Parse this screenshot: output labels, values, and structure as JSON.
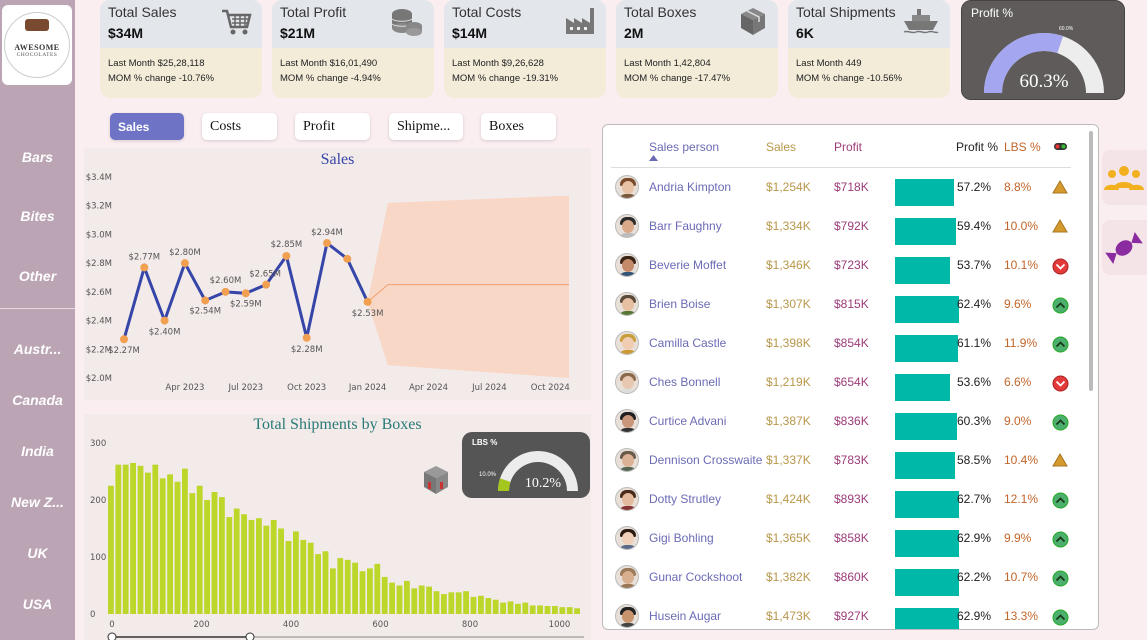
{
  "logo": {
    "line1": "AWESOME",
    "line2": "CHOCOLATES"
  },
  "sidebar": {
    "products": [
      "Bars",
      "Bites",
      "Other"
    ],
    "countries": [
      "Austr...",
      "Canada",
      "India",
      "New Z...",
      "UK",
      "USA"
    ]
  },
  "kpis": [
    {
      "title": "Total Sales",
      "value": "$34M",
      "last": "Last Month $25,28,118",
      "mom": "MOM % change -10.76%",
      "icon": "shopping-cart-icon"
    },
    {
      "title": "Total Profit",
      "value": "$21M",
      "last": "Last Month $16,01,490",
      "mom": "MOM % change -4.94%",
      "icon": "coins-icon"
    },
    {
      "title": "Total Costs",
      "value": "$14M",
      "last": "Last Month $9,26,628",
      "mom": "MOM % change -19.31%",
      "icon": "factory-icon"
    },
    {
      "title": "Total Boxes",
      "value": "2M",
      "last": "Last Month 1,42,804",
      "mom": "MOM % change -17.47%",
      "icon": "box-icon"
    },
    {
      "title": "Total Shipments",
      "value": "6K",
      "last": "Last Month 449",
      "mom": "MOM % change -10.56%",
      "icon": "ship-icon"
    }
  ],
  "profit_gauge": {
    "title": "Profit %",
    "value": "60.3%",
    "target": "60.0%",
    "fraction": 0.603
  },
  "tabs": [
    "Sales",
    "Costs",
    "Profit",
    "Shipme...",
    "Boxes"
  ],
  "active_tab": "Sales",
  "chart_data": [
    {
      "type": "line",
      "title": "Sales",
      "x": [
        "2023-01",
        "2023-02",
        "2023-03",
        "2023-04",
        "2023-05",
        "2023-06",
        "2023-07",
        "2023-08",
        "2023-09",
        "2023-10",
        "2023-11",
        "2023-12",
        "2024-01",
        "2024-02"
      ],
      "values": [
        2.27,
        2.77,
        2.4,
        2.8,
        2.54,
        2.6,
        2.59,
        2.65,
        2.85,
        2.28,
        2.94,
        2.83,
        2.53
      ],
      "data_labels": [
        "$2.27M",
        "$2.77M",
        "$2.40M",
        "$2.80M",
        "$2.54M",
        "$2.60M",
        "$2.59M",
        "$2.65M",
        "$2.85M",
        "$2.28M",
        "$2.94M",
        "",
        "$2.53M"
      ],
      "forecast": {
        "value": 2.65,
        "upper_end": 3.27,
        "lower_end": 2.0
      },
      "yticks": [
        "$3.4M",
        "$3.2M",
        "$3.0M",
        "$2.8M",
        "$2.6M",
        "$2.4M",
        "$2.2M",
        "$2.0M"
      ],
      "xticks": [
        "Apr 2023",
        "Jul 2023",
        "Oct 2023",
        "Jan 2024",
        "Apr 2024",
        "Jul 2024",
        "Oct 2024"
      ],
      "ylim": [
        2.0,
        3.4
      ],
      "color": "#3545a8",
      "marker_color": "#f0a050",
      "forecast_color": "#f8d5c2"
    },
    {
      "type": "bar",
      "title": "Total Shipments by Boxes",
      "values": [
        225,
        262,
        262,
        265,
        260,
        248,
        262,
        238,
        245,
        232,
        255,
        212,
        225,
        200,
        214,
        205,
        170,
        185,
        175,
        165,
        168,
        155,
        165,
        150,
        128,
        145,
        130,
        125,
        105,
        110,
        80,
        98,
        95,
        90,
        75,
        80,
        88,
        65,
        55,
        50,
        58,
        45,
        50,
        48,
        40,
        35,
        38,
        38,
        40,
        30,
        32,
        28,
        25,
        20,
        22,
        18,
        20,
        15,
        15,
        14,
        14,
        12,
        12,
        10
      ],
      "xticks": [
        "0",
        "200",
        "400",
        "600",
        "800",
        "1000"
      ],
      "yticks": [
        "300",
        "200",
        "100",
        "0"
      ],
      "ylim": [
        0,
        300
      ],
      "color": "#bcd62a"
    }
  ],
  "lbs_gauge": {
    "title": "LBS %",
    "value": "10.2%",
    "target": "10.0%",
    "fraction": 0.102
  },
  "table": {
    "headers": {
      "name": "Sales person",
      "sales": "Sales",
      "profit": "Profit",
      "pp": "Profit %",
      "lbs": "LBS %"
    },
    "rows": [
      {
        "name": "Andria Kimpton",
        "sales": "$1,254K",
        "profit": "$718K",
        "pp": "57.2%",
        "lbs": "8.8%",
        "pct": 57.2,
        "ind": "warn"
      },
      {
        "name": "Barr Faughny",
        "sales": "$1,334K",
        "profit": "$792K",
        "pp": "59.4%",
        "lbs": "10.0%",
        "pct": 59.4,
        "ind": "warn"
      },
      {
        "name": "Beverie Moffet",
        "sales": "$1,346K",
        "profit": "$723K",
        "pp": "53.7%",
        "lbs": "10.1%",
        "pct": 53.7,
        "ind": "down"
      },
      {
        "name": "Brien Boise",
        "sales": "$1,307K",
        "profit": "$815K",
        "pp": "62.4%",
        "lbs": "9.6%",
        "pct": 62.4,
        "ind": "up"
      },
      {
        "name": "Camilla Castle",
        "sales": "$1,398K",
        "profit": "$854K",
        "pp": "61.1%",
        "lbs": "11.9%",
        "pct": 61.1,
        "ind": "up"
      },
      {
        "name": "Ches Bonnell",
        "sales": "$1,219K",
        "profit": "$654K",
        "pp": "53.6%",
        "lbs": "6.6%",
        "pct": 53.6,
        "ind": "down"
      },
      {
        "name": "Curtice Advani",
        "sales": "$1,387K",
        "profit": "$836K",
        "pp": "60.3%",
        "lbs": "9.0%",
        "pct": 60.3,
        "ind": "up"
      },
      {
        "name": "Dennison Crosswaite",
        "sales": "$1,337K",
        "profit": "$783K",
        "pp": "58.5%",
        "lbs": "10.4%",
        "pct": 58.5,
        "ind": "warn"
      },
      {
        "name": "Dotty Strutley",
        "sales": "$1,424K",
        "profit": "$893K",
        "pp": "62.7%",
        "lbs": "12.1%",
        "pct": 62.7,
        "ind": "up"
      },
      {
        "name": "Gigi Bohling",
        "sales": "$1,365K",
        "profit": "$858K",
        "pp": "62.9%",
        "lbs": "9.9%",
        "pct": 62.9,
        "ind": "up"
      },
      {
        "name": "Gunar Cockshoot",
        "sales": "$1,382K",
        "profit": "$860K",
        "pp": "62.2%",
        "lbs": "10.7%",
        "pct": 62.2,
        "ind": "up"
      },
      {
        "name": "Husein Augar",
        "sales": "$1,473K",
        "profit": "$927K",
        "pp": "62.9%",
        "lbs": "13.3%",
        "pct": 62.9,
        "ind": "up"
      }
    ]
  },
  "right_buttons": [
    "people-icon",
    "candy-icon"
  ]
}
